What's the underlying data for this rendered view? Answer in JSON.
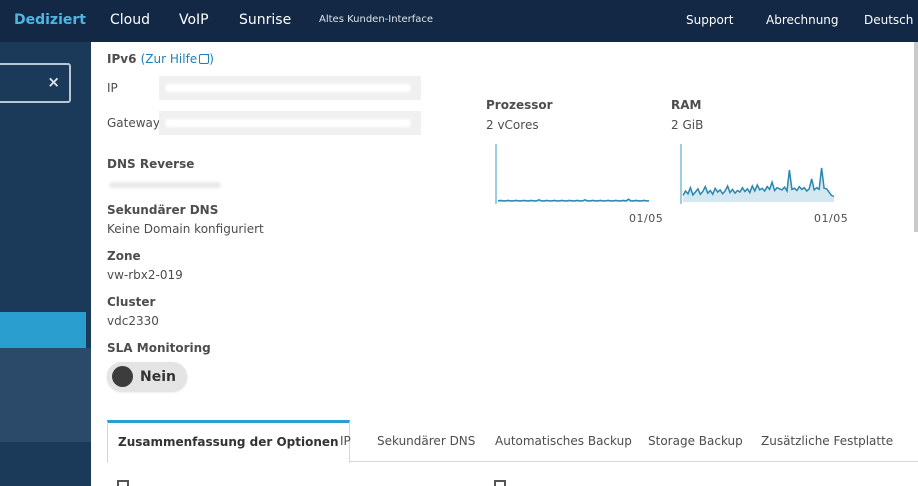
{
  "topnav": {
    "brand": "Dediziert",
    "items": [
      "Cloud",
      "VoIP",
      "Sunrise"
    ],
    "legacy": "Altes Kunden-Interface",
    "right": [
      "Support",
      "Abrechnung",
      "Deutsch"
    ]
  },
  "sidebar": {
    "clear_symbol": "×"
  },
  "details": {
    "ipv6_title": "IPv6",
    "help_link": "(Zur Hilfe",
    "ip_label": "IP",
    "gateway_label": "Gateway",
    "dns_reverse_label": "DNS Reverse",
    "secondary_dns_label": "Sekundärer DNS",
    "secondary_dns_value": "Keine Domain konfiguriert",
    "zone_label": "Zone",
    "zone_value": "vw-rbx2-019",
    "cluster_label": "Cluster",
    "cluster_value": "vdc2330",
    "sla_label": "SLA Monitoring",
    "sla_value": "Nein"
  },
  "processor": {
    "title": "Prozessor",
    "value": "2 vCores",
    "date_label": "01/05",
    "series": [
      0.2,
      0.3,
      0.2,
      0.2,
      0.3,
      0.2,
      0.2,
      0.3,
      0.2,
      0.2,
      0.3,
      0.2,
      0.2,
      0.3,
      0.2,
      0.2,
      0.4,
      0.2,
      0.2,
      0.3,
      0.2,
      0.2,
      0.3,
      0.2,
      0.2,
      0.3,
      0.2,
      0.2,
      0.3,
      0.2,
      0.2,
      0.3,
      0.2,
      0.2,
      0.4,
      0.2,
      0.2,
      0.3,
      0.2,
      0.2,
      0.3,
      0.2,
      0.2,
      0.3,
      0.2,
      0.2,
      0.3,
      0.2,
      0.2,
      0.3,
      0.2,
      0.5,
      0.2,
      0.2,
      0.3,
      0.2,
      0.2,
      0.3,
      0.2,
      0.2
    ]
  },
  "ram": {
    "title": "RAM",
    "value": "2 GiB",
    "date_label": "01/05",
    "series": [
      1.2,
      2.0,
      1.5,
      2.6,
      1.3,
      1.8,
      2.4,
      1.4,
      1.9,
      2.8,
      1.6,
      2.1,
      1.4,
      2.5,
      1.8,
      2.2,
      1.5,
      2.0,
      2.9,
      1.7,
      2.3,
      1.6,
      2.1,
      1.8,
      2.6,
      1.9,
      2.4,
      1.7,
      2.9,
      2.0,
      3.1,
      2.2,
      2.5,
      2.0,
      2.8,
      2.3,
      3.6,
      2.1,
      2.6,
      2.4,
      2.2,
      2.7,
      2.0,
      5.8,
      2.3,
      2.5,
      2.1,
      2.8,
      2.3,
      2.6,
      2.0,
      2.4,
      4.2,
      2.2,
      2.6,
      2.3,
      6.2,
      2.5,
      2.4,
      1.8,
      1.2,
      1.0
    ]
  },
  "tabs": [
    "Zusammenfassung der Optionen",
    "IP",
    "Sekundärer DNS",
    "Automatisches Backup",
    "Storage Backup",
    "Zusätzliche Festplatte"
  ]
}
